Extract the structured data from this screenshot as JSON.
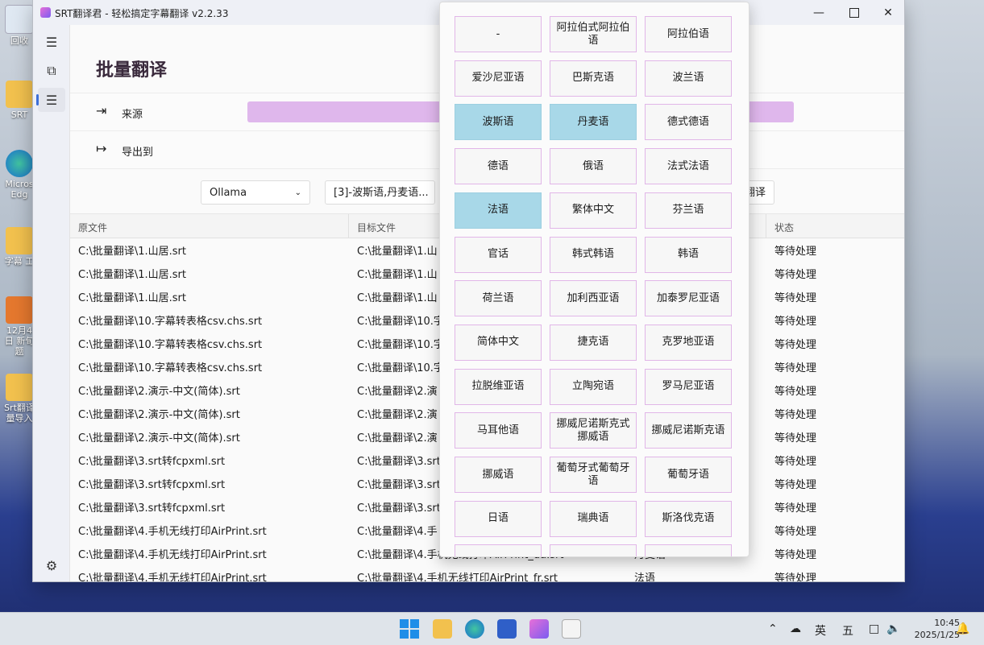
{
  "window": {
    "title": "SRT翻译君 - 轻松搞定字幕翻译 v2.2.33"
  },
  "desktop": [
    "回收",
    "SRT",
    "Micros Edg",
    "字幕 工",
    "12月4日 新旬题",
    "Srt翻译 量导入"
  ],
  "page": {
    "title": "批量翻译",
    "source_label": "来源",
    "export_label": "导出到",
    "engine_value": "Ollama",
    "languages_value": "[3]-波斯语,丹麦语...",
    "translate_button": "翻译"
  },
  "table": {
    "headers": [
      "原文件",
      "目标文件",
      "状态"
    ],
    "rows": [
      {
        "src": "C:\\批量翻译\\1.山居.srt",
        "dst": "C:\\批量翻译\\1.山",
        "lang": "",
        "status": "等待处理"
      },
      {
        "src": "C:\\批量翻译\\1.山居.srt",
        "dst": "C:\\批量翻译\\1.山",
        "lang": "",
        "status": "等待处理"
      },
      {
        "src": "C:\\批量翻译\\1.山居.srt",
        "dst": "C:\\批量翻译\\1.山",
        "lang": "",
        "status": "等待处理"
      },
      {
        "src": "C:\\批量翻译\\10.字幕转表格csv.chs.srt",
        "dst": "C:\\批量翻译\\10.字",
        "lang": "",
        "status": "等待处理"
      },
      {
        "src": "C:\\批量翻译\\10.字幕转表格csv.chs.srt",
        "dst": "C:\\批量翻译\\10.字",
        "lang": "",
        "status": "等待处理"
      },
      {
        "src": "C:\\批量翻译\\10.字幕转表格csv.chs.srt",
        "dst": "C:\\批量翻译\\10.字",
        "lang": "",
        "status": "等待处理"
      },
      {
        "src": "C:\\批量翻译\\2.演示-中文(简体).srt",
        "dst": "C:\\批量翻译\\2.演",
        "lang": "",
        "status": "等待处理"
      },
      {
        "src": "C:\\批量翻译\\2.演示-中文(简体).srt",
        "dst": "C:\\批量翻译\\2.演",
        "lang": "",
        "status": "等待处理"
      },
      {
        "src": "C:\\批量翻译\\2.演示-中文(简体).srt",
        "dst": "C:\\批量翻译\\2.演",
        "lang": "",
        "status": "等待处理"
      },
      {
        "src": "C:\\批量翻译\\3.srt转fcpxml.srt",
        "dst": "C:\\批量翻译\\3.srt",
        "lang": "",
        "status": "等待处理"
      },
      {
        "src": "C:\\批量翻译\\3.srt转fcpxml.srt",
        "dst": "C:\\批量翻译\\3.srt",
        "lang": "",
        "status": "等待处理"
      },
      {
        "src": "C:\\批量翻译\\3.srt转fcpxml.srt",
        "dst": "C:\\批量翻译\\3.srt",
        "lang": "",
        "status": "等待处理"
      },
      {
        "src": "C:\\批量翻译\\4.手机无线打印AirPrint.srt",
        "dst": "C:\\批量翻译\\4.手",
        "lang": "",
        "status": "等待处理"
      },
      {
        "src": "C:\\批量翻译\\4.手机无线打印AirPrint.srt",
        "dst": "C:\\批量翻译\\4.手机无线打印AirPrint_da.srt",
        "lang": "丹麦语",
        "status": "等待处理"
      },
      {
        "src": "C:\\批量翻译\\4.手机无线打印AirPrint.srt",
        "dst": "C:\\批量翻译\\4.手机无线打印AirPrint_fr.srt",
        "lang": "法语",
        "status": "等待处理"
      }
    ]
  },
  "language_popup": {
    "items": [
      {
        "label": "-",
        "selected": false
      },
      {
        "label": "阿拉伯式阿拉伯语",
        "selected": false
      },
      {
        "label": "阿拉伯语",
        "selected": false
      },
      {
        "label": "爱沙尼亚语",
        "selected": false
      },
      {
        "label": "巴斯克语",
        "selected": false
      },
      {
        "label": "波兰语",
        "selected": false
      },
      {
        "label": "波斯语",
        "selected": true
      },
      {
        "label": "丹麦语",
        "selected": true
      },
      {
        "label": "德式德语",
        "selected": false
      },
      {
        "label": "德语",
        "selected": false
      },
      {
        "label": "俄语",
        "selected": false
      },
      {
        "label": "法式法语",
        "selected": false
      },
      {
        "label": "法语",
        "selected": true
      },
      {
        "label": "繁体中文",
        "selected": false
      },
      {
        "label": "芬兰语",
        "selected": false
      },
      {
        "label": "官话",
        "selected": false
      },
      {
        "label": "韩式韩语",
        "selected": false
      },
      {
        "label": "韩语",
        "selected": false
      },
      {
        "label": "荷兰语",
        "selected": false
      },
      {
        "label": "加利西亚语",
        "selected": false
      },
      {
        "label": "加泰罗尼亚语",
        "selected": false
      },
      {
        "label": "简体中文",
        "selected": false
      },
      {
        "label": "捷克语",
        "selected": false
      },
      {
        "label": "克罗地亚语",
        "selected": false
      },
      {
        "label": "拉脱维亚语",
        "selected": false
      },
      {
        "label": "立陶宛语",
        "selected": false
      },
      {
        "label": "罗马尼亚语",
        "selected": false
      },
      {
        "label": "马耳他语",
        "selected": false
      },
      {
        "label": "挪威尼诺斯克式挪威语",
        "selected": false
      },
      {
        "label": "挪威尼诺斯克语",
        "selected": false
      },
      {
        "label": "挪威语",
        "selected": false
      },
      {
        "label": "葡萄牙式葡萄牙语",
        "selected": false
      },
      {
        "label": "葡萄牙语",
        "selected": false
      },
      {
        "label": "日语",
        "selected": false
      },
      {
        "label": "瑞典语",
        "selected": false
      },
      {
        "label": "斯洛伐克语",
        "selected": false
      }
    ],
    "selected_color": "#a8d8e8"
  },
  "taskbar": {
    "ime": "英",
    "ime2": "五",
    "time": "10:45",
    "date": "2025/1/25"
  }
}
